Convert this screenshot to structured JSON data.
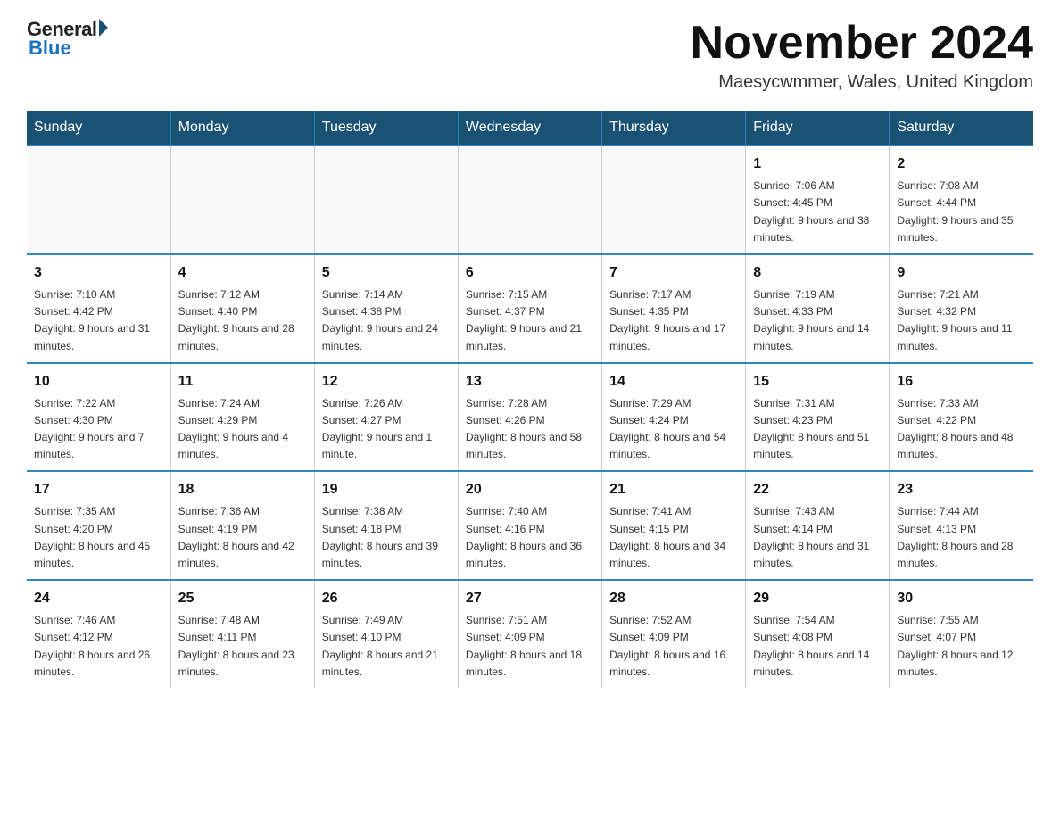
{
  "logo": {
    "general": "General",
    "blue": "Blue"
  },
  "title": "November 2024",
  "location": "Maesycwmmer, Wales, United Kingdom",
  "days_header": [
    "Sunday",
    "Monday",
    "Tuesday",
    "Wednesday",
    "Thursday",
    "Friday",
    "Saturday"
  ],
  "weeks": [
    [
      {
        "num": "",
        "sunrise": "",
        "sunset": "",
        "daylight": ""
      },
      {
        "num": "",
        "sunrise": "",
        "sunset": "",
        "daylight": ""
      },
      {
        "num": "",
        "sunrise": "",
        "sunset": "",
        "daylight": ""
      },
      {
        "num": "",
        "sunrise": "",
        "sunset": "",
        "daylight": ""
      },
      {
        "num": "",
        "sunrise": "",
        "sunset": "",
        "daylight": ""
      },
      {
        "num": "1",
        "sunrise": "Sunrise: 7:06 AM",
        "sunset": "Sunset: 4:45 PM",
        "daylight": "Daylight: 9 hours and 38 minutes."
      },
      {
        "num": "2",
        "sunrise": "Sunrise: 7:08 AM",
        "sunset": "Sunset: 4:44 PM",
        "daylight": "Daylight: 9 hours and 35 minutes."
      }
    ],
    [
      {
        "num": "3",
        "sunrise": "Sunrise: 7:10 AM",
        "sunset": "Sunset: 4:42 PM",
        "daylight": "Daylight: 9 hours and 31 minutes."
      },
      {
        "num": "4",
        "sunrise": "Sunrise: 7:12 AM",
        "sunset": "Sunset: 4:40 PM",
        "daylight": "Daylight: 9 hours and 28 minutes."
      },
      {
        "num": "5",
        "sunrise": "Sunrise: 7:14 AM",
        "sunset": "Sunset: 4:38 PM",
        "daylight": "Daylight: 9 hours and 24 minutes."
      },
      {
        "num": "6",
        "sunrise": "Sunrise: 7:15 AM",
        "sunset": "Sunset: 4:37 PM",
        "daylight": "Daylight: 9 hours and 21 minutes."
      },
      {
        "num": "7",
        "sunrise": "Sunrise: 7:17 AM",
        "sunset": "Sunset: 4:35 PM",
        "daylight": "Daylight: 9 hours and 17 minutes."
      },
      {
        "num": "8",
        "sunrise": "Sunrise: 7:19 AM",
        "sunset": "Sunset: 4:33 PM",
        "daylight": "Daylight: 9 hours and 14 minutes."
      },
      {
        "num": "9",
        "sunrise": "Sunrise: 7:21 AM",
        "sunset": "Sunset: 4:32 PM",
        "daylight": "Daylight: 9 hours and 11 minutes."
      }
    ],
    [
      {
        "num": "10",
        "sunrise": "Sunrise: 7:22 AM",
        "sunset": "Sunset: 4:30 PM",
        "daylight": "Daylight: 9 hours and 7 minutes."
      },
      {
        "num": "11",
        "sunrise": "Sunrise: 7:24 AM",
        "sunset": "Sunset: 4:29 PM",
        "daylight": "Daylight: 9 hours and 4 minutes."
      },
      {
        "num": "12",
        "sunrise": "Sunrise: 7:26 AM",
        "sunset": "Sunset: 4:27 PM",
        "daylight": "Daylight: 9 hours and 1 minute."
      },
      {
        "num": "13",
        "sunrise": "Sunrise: 7:28 AM",
        "sunset": "Sunset: 4:26 PM",
        "daylight": "Daylight: 8 hours and 58 minutes."
      },
      {
        "num": "14",
        "sunrise": "Sunrise: 7:29 AM",
        "sunset": "Sunset: 4:24 PM",
        "daylight": "Daylight: 8 hours and 54 minutes."
      },
      {
        "num": "15",
        "sunrise": "Sunrise: 7:31 AM",
        "sunset": "Sunset: 4:23 PM",
        "daylight": "Daylight: 8 hours and 51 minutes."
      },
      {
        "num": "16",
        "sunrise": "Sunrise: 7:33 AM",
        "sunset": "Sunset: 4:22 PM",
        "daylight": "Daylight: 8 hours and 48 minutes."
      }
    ],
    [
      {
        "num": "17",
        "sunrise": "Sunrise: 7:35 AM",
        "sunset": "Sunset: 4:20 PM",
        "daylight": "Daylight: 8 hours and 45 minutes."
      },
      {
        "num": "18",
        "sunrise": "Sunrise: 7:36 AM",
        "sunset": "Sunset: 4:19 PM",
        "daylight": "Daylight: 8 hours and 42 minutes."
      },
      {
        "num": "19",
        "sunrise": "Sunrise: 7:38 AM",
        "sunset": "Sunset: 4:18 PM",
        "daylight": "Daylight: 8 hours and 39 minutes."
      },
      {
        "num": "20",
        "sunrise": "Sunrise: 7:40 AM",
        "sunset": "Sunset: 4:16 PM",
        "daylight": "Daylight: 8 hours and 36 minutes."
      },
      {
        "num": "21",
        "sunrise": "Sunrise: 7:41 AM",
        "sunset": "Sunset: 4:15 PM",
        "daylight": "Daylight: 8 hours and 34 minutes."
      },
      {
        "num": "22",
        "sunrise": "Sunrise: 7:43 AM",
        "sunset": "Sunset: 4:14 PM",
        "daylight": "Daylight: 8 hours and 31 minutes."
      },
      {
        "num": "23",
        "sunrise": "Sunrise: 7:44 AM",
        "sunset": "Sunset: 4:13 PM",
        "daylight": "Daylight: 8 hours and 28 minutes."
      }
    ],
    [
      {
        "num": "24",
        "sunrise": "Sunrise: 7:46 AM",
        "sunset": "Sunset: 4:12 PM",
        "daylight": "Daylight: 8 hours and 26 minutes."
      },
      {
        "num": "25",
        "sunrise": "Sunrise: 7:48 AM",
        "sunset": "Sunset: 4:11 PM",
        "daylight": "Daylight: 8 hours and 23 minutes."
      },
      {
        "num": "26",
        "sunrise": "Sunrise: 7:49 AM",
        "sunset": "Sunset: 4:10 PM",
        "daylight": "Daylight: 8 hours and 21 minutes."
      },
      {
        "num": "27",
        "sunrise": "Sunrise: 7:51 AM",
        "sunset": "Sunset: 4:09 PM",
        "daylight": "Daylight: 8 hours and 18 minutes."
      },
      {
        "num": "28",
        "sunrise": "Sunrise: 7:52 AM",
        "sunset": "Sunset: 4:09 PM",
        "daylight": "Daylight: 8 hours and 16 minutes."
      },
      {
        "num": "29",
        "sunrise": "Sunrise: 7:54 AM",
        "sunset": "Sunset: 4:08 PM",
        "daylight": "Daylight: 8 hours and 14 minutes."
      },
      {
        "num": "30",
        "sunrise": "Sunrise: 7:55 AM",
        "sunset": "Sunset: 4:07 PM",
        "daylight": "Daylight: 8 hours and 12 minutes."
      }
    ]
  ]
}
